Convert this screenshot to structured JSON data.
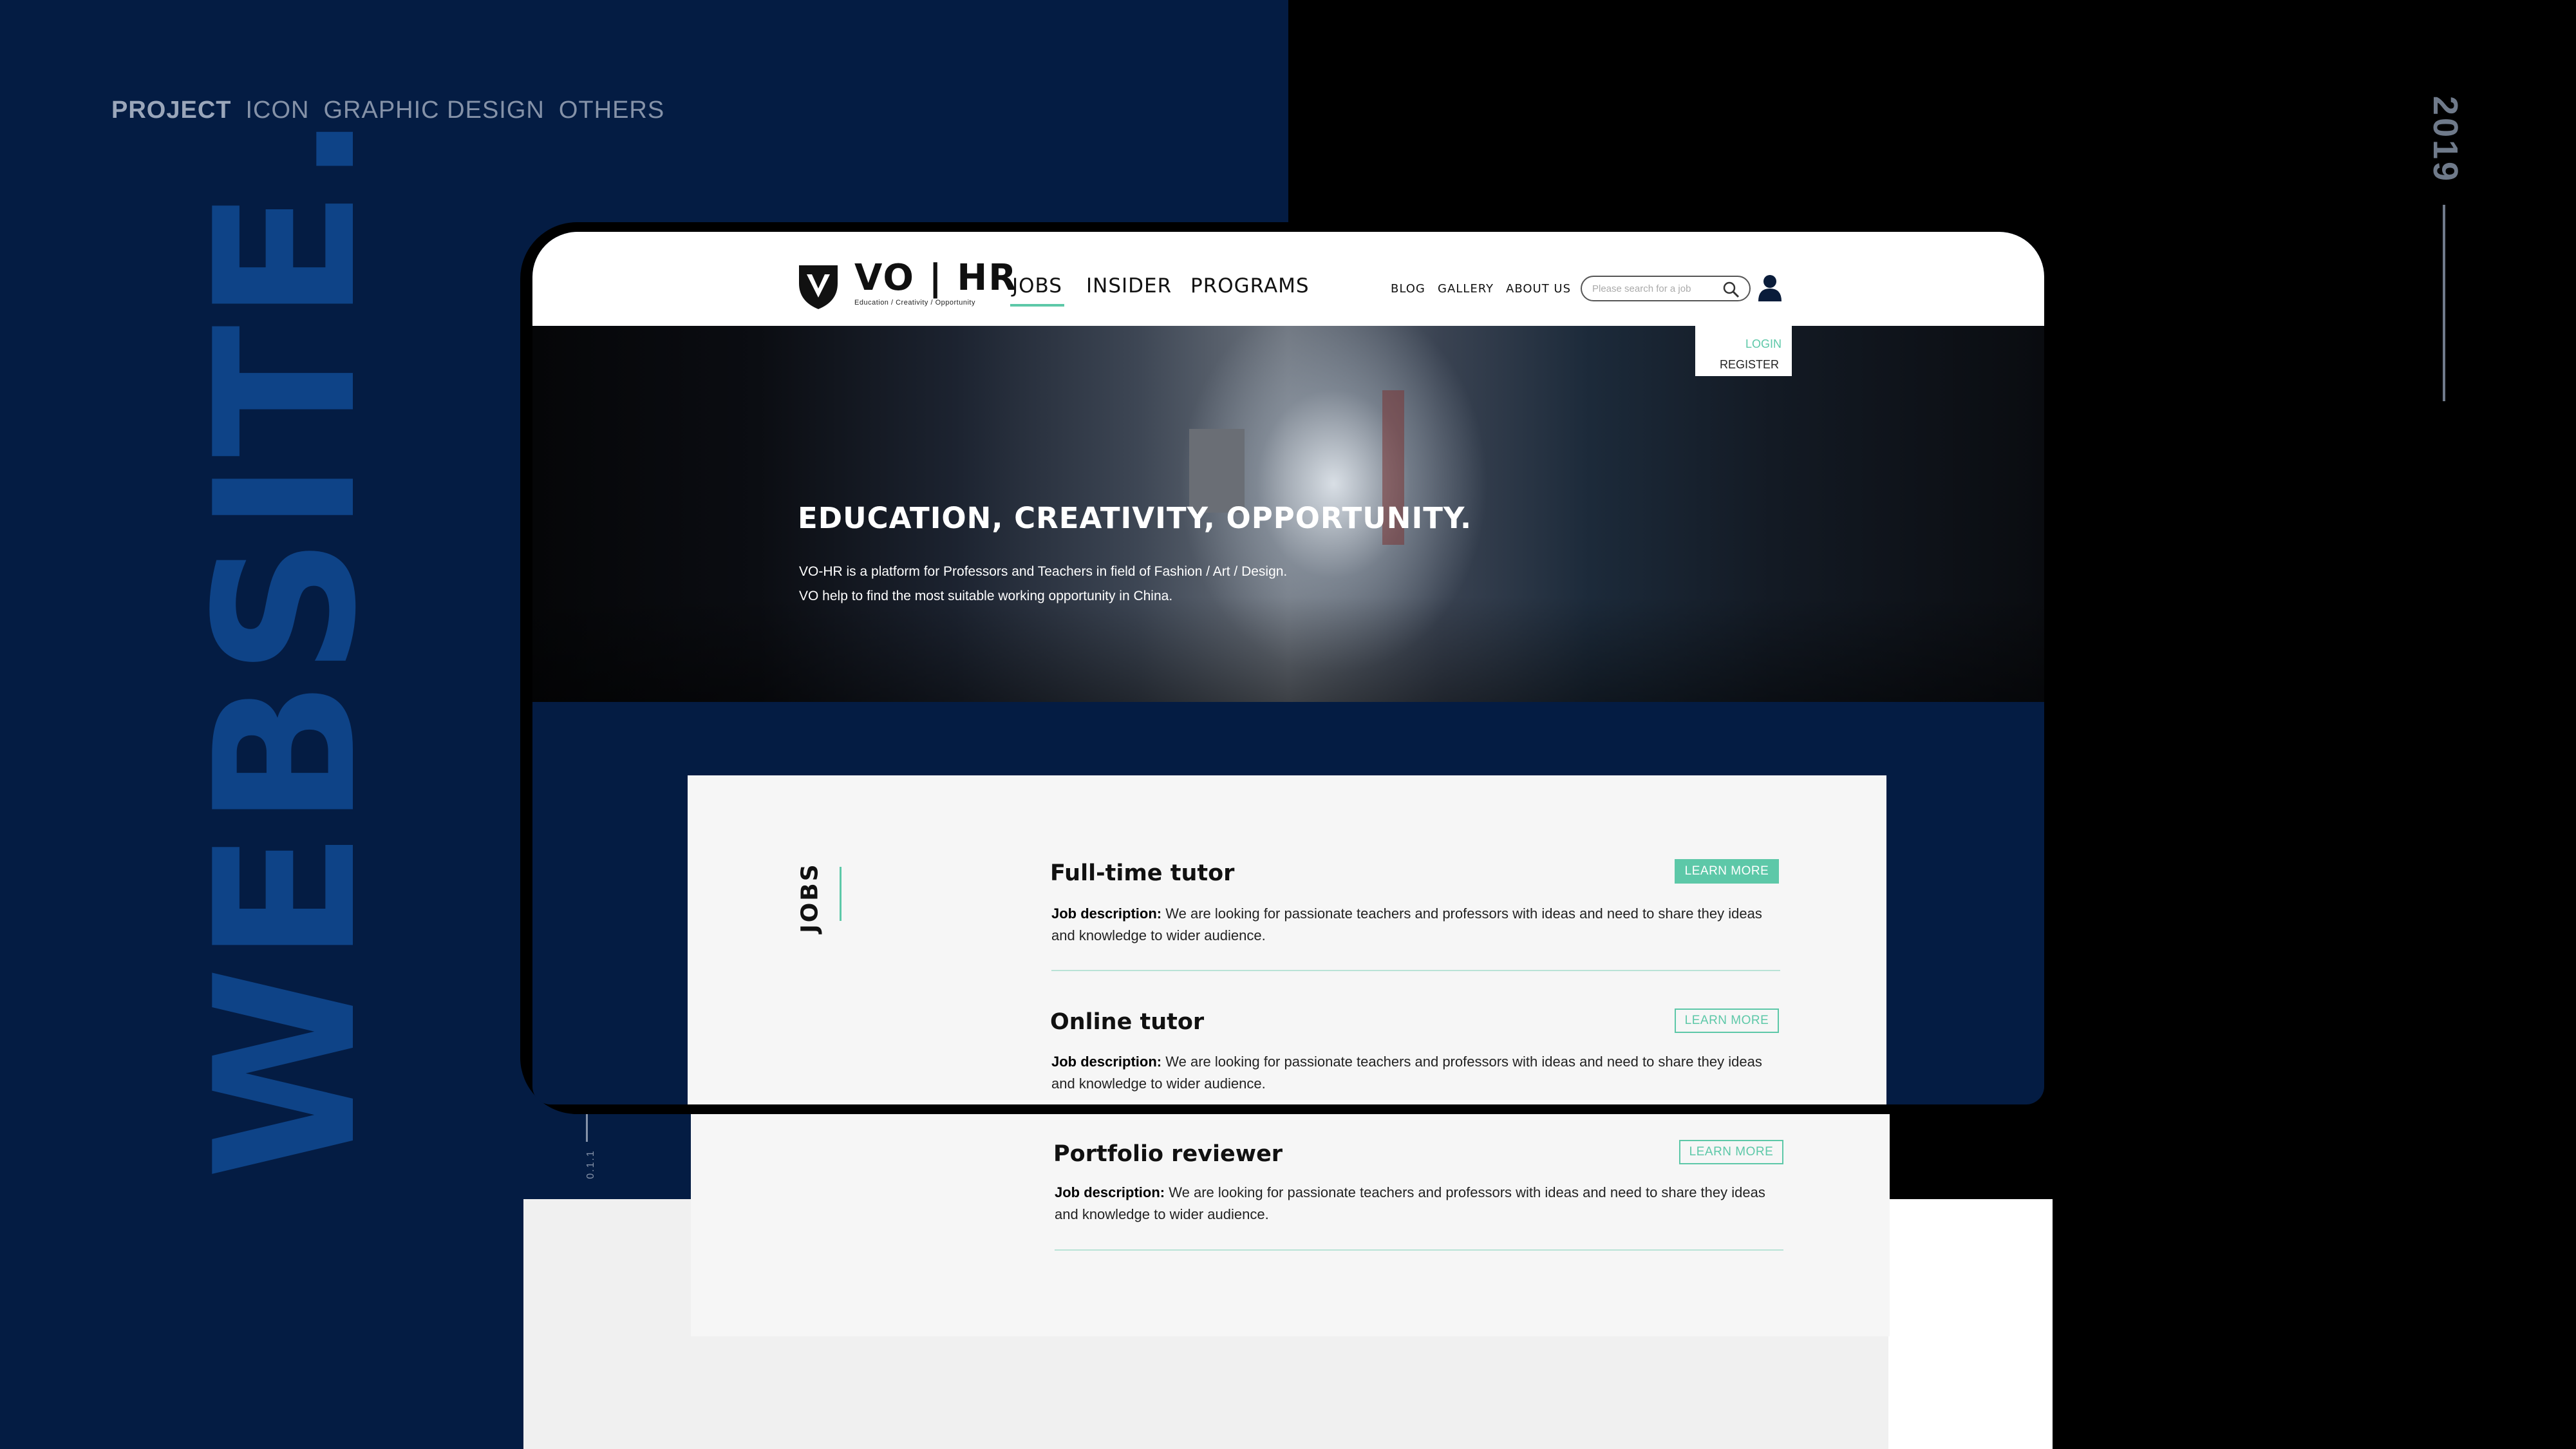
{
  "portfolio_nav": {
    "items": [
      "PROJECT",
      "ICON",
      "GRAPHIC DESIGN",
      "OTHERS"
    ]
  },
  "big_title": "WEBSITE.",
  "year": "2019",
  "side_index": "0.1.1",
  "site": {
    "logo_text": "VO | HR",
    "logo_tagline": "Education / Creativity / Opportunity",
    "main_nav": [
      "JOBS",
      "INSIDER",
      "PROGRAMS"
    ],
    "sub_nav": [
      "BLOG",
      "GALLERY",
      "ABOUT US"
    ],
    "search_placeholder": "Please search for a job",
    "account_menu": {
      "login": "LOGIN",
      "register": "REGISTER"
    }
  },
  "hero": {
    "title": "EDUCATION, CREATIVITY, OPPORTUNITY.",
    "line1": "VO-HR is a platform for Professors and Teachers in field of Fashion / Art / Design.",
    "line2": "VO help to find the most suitable working opportunity in China."
  },
  "jobs": {
    "section_label": "JOBS",
    "desc_prefix": "Job description:",
    "button_label": "LEARN MORE",
    "items": [
      {
        "title": "Full-time tutor",
        "description": "We are looking for passionate teachers and professors with ideas and need to share they ideas and knowledge to wider audience."
      },
      {
        "title": "Online tutor",
        "description": "We are looking for passionate teachers and professors with ideas and need to share they ideas and knowledge to wider audience."
      },
      {
        "title": "Portfolio reviewer",
        "description": "We are looking for passionate teachers and professors with ideas and need to share they ideas and knowledge to wider audience."
      }
    ]
  },
  "colors": {
    "navy": "#041c43",
    "title_blue": "#0e4387",
    "accent_green": "#5dc8a8"
  }
}
